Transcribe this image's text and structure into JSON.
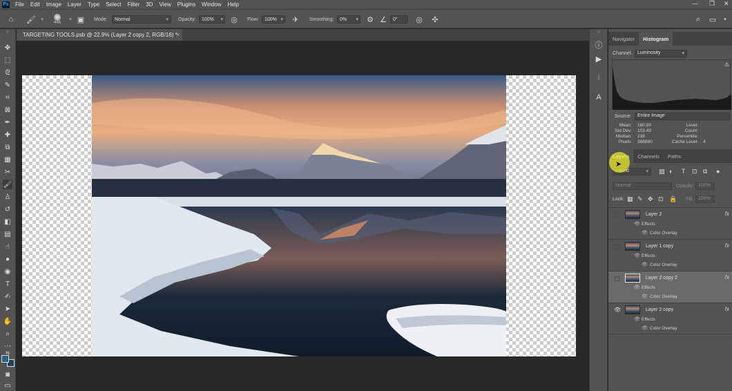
{
  "menubar": {
    "items": [
      "File",
      "Edit",
      "Image",
      "Layer",
      "Type",
      "Select",
      "Filter",
      "3D",
      "View",
      "Plugins",
      "Window",
      "Help"
    ],
    "logo": "Ps"
  },
  "options": {
    "brush_size": "446",
    "mode_label": "Mode:",
    "mode_value": "Normal",
    "opacity_label": "Opacity:",
    "opacity_value": "100%",
    "flow_label": "Flow:",
    "flow_value": "100%",
    "smoothing_label": "Smoothing:",
    "smoothing_value": "0%",
    "angle_value": "0°"
  },
  "document": {
    "tab_title": "TARGETING TOOLS.psb @ 22.9% (Layer 2 copy 2, RGB/16) *",
    "close": "×"
  },
  "histogram": {
    "tabs": [
      "Navigator",
      "Histogram"
    ],
    "active_tab": "Histogram",
    "channel_label": "Channel:",
    "channel_value": "Luminosity",
    "source_label": "Source:",
    "source_value": "Entire Image",
    "stats_left_labels": [
      "Mean:",
      "Std Dev:",
      "Median:",
      "Pixels:"
    ],
    "stats_left_values": [
      "160.89",
      "103.49",
      "238",
      "388880"
    ],
    "stats_right_labels": [
      "Level:",
      "Count:",
      "Percentile:",
      "Cache Level:"
    ],
    "stats_right_values": [
      "",
      "",
      "",
      "4"
    ]
  },
  "layers_panel": {
    "tabs": [
      "Layers",
      "Channels",
      "Paths"
    ],
    "active_tab": "Layers",
    "kind_value": "Kind",
    "blend_mode": "Normal",
    "opacity_label": "Opacity:",
    "opacity_value": "100%",
    "lock_label": "Lock:",
    "fill_label": "Fill:",
    "fill_value": "100%",
    "fx": "fx",
    "effects_label": "Effects",
    "color_overlay_label": "Color Overlay",
    "layers": [
      {
        "name": "Layer 2",
        "visible": false,
        "selected": false
      },
      {
        "name": "Layer 1 copy",
        "visible": false,
        "selected": false
      },
      {
        "name": "Layer 2 copy 2",
        "visible": false,
        "selected": true
      },
      {
        "name": "Layer 2 copy",
        "visible": true,
        "selected": false
      }
    ]
  },
  "colors": {
    "panel_bg": "#535353",
    "canvas_bg": "#282828",
    "tab_bar": "#424242",
    "selected_layer": "#6a6a6a",
    "foreground_swatch": "#2e5f8a",
    "background_swatch": "#1f3f5e"
  }
}
